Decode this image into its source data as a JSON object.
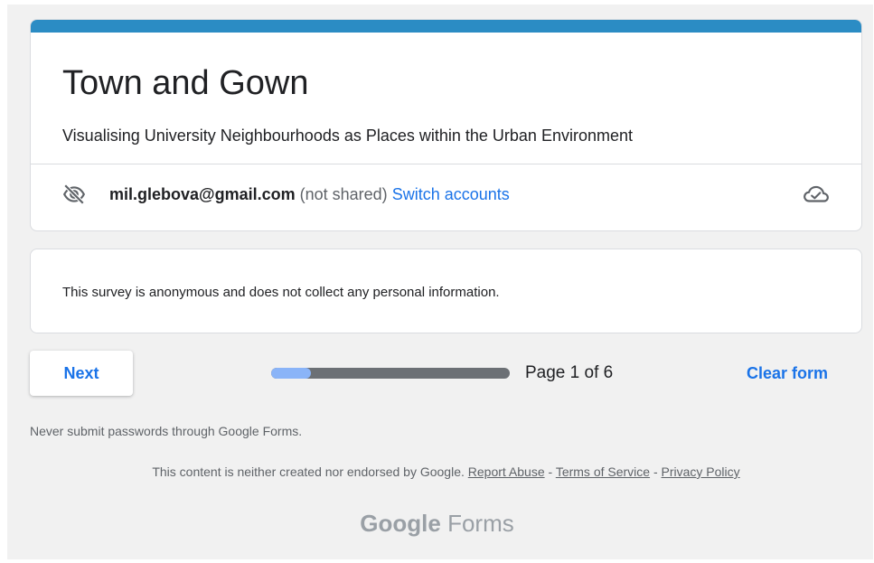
{
  "form": {
    "title": "Town and Gown",
    "description": "Visualising University Neighbourhoods as Places within the Urban Environment",
    "accent_color": "#2b8cc4"
  },
  "account": {
    "email": "mil.glebova@gmail.com",
    "note": "(not shared)",
    "switch_label": "Switch accounts",
    "privacy_icon": "eye-off-icon",
    "save_status_icon": "cloud-check-icon"
  },
  "notice": {
    "text": "This survey is anonymous and does not collect any personal information."
  },
  "navigation": {
    "next_label": "Next",
    "progress_fraction": 0.167,
    "page_indicator": "Page 1 of 6",
    "clear_label": "Clear form"
  },
  "footer": {
    "password_warning": "Never submit passwords through Google Forms.",
    "disclaimer_text": "This content is neither created nor endorsed by Google.",
    "report_abuse": "Report Abuse",
    "terms": "Terms of Service",
    "privacy": "Privacy Policy",
    "separator": "-",
    "brand_google": "Google",
    "brand_forms": "Forms"
  }
}
